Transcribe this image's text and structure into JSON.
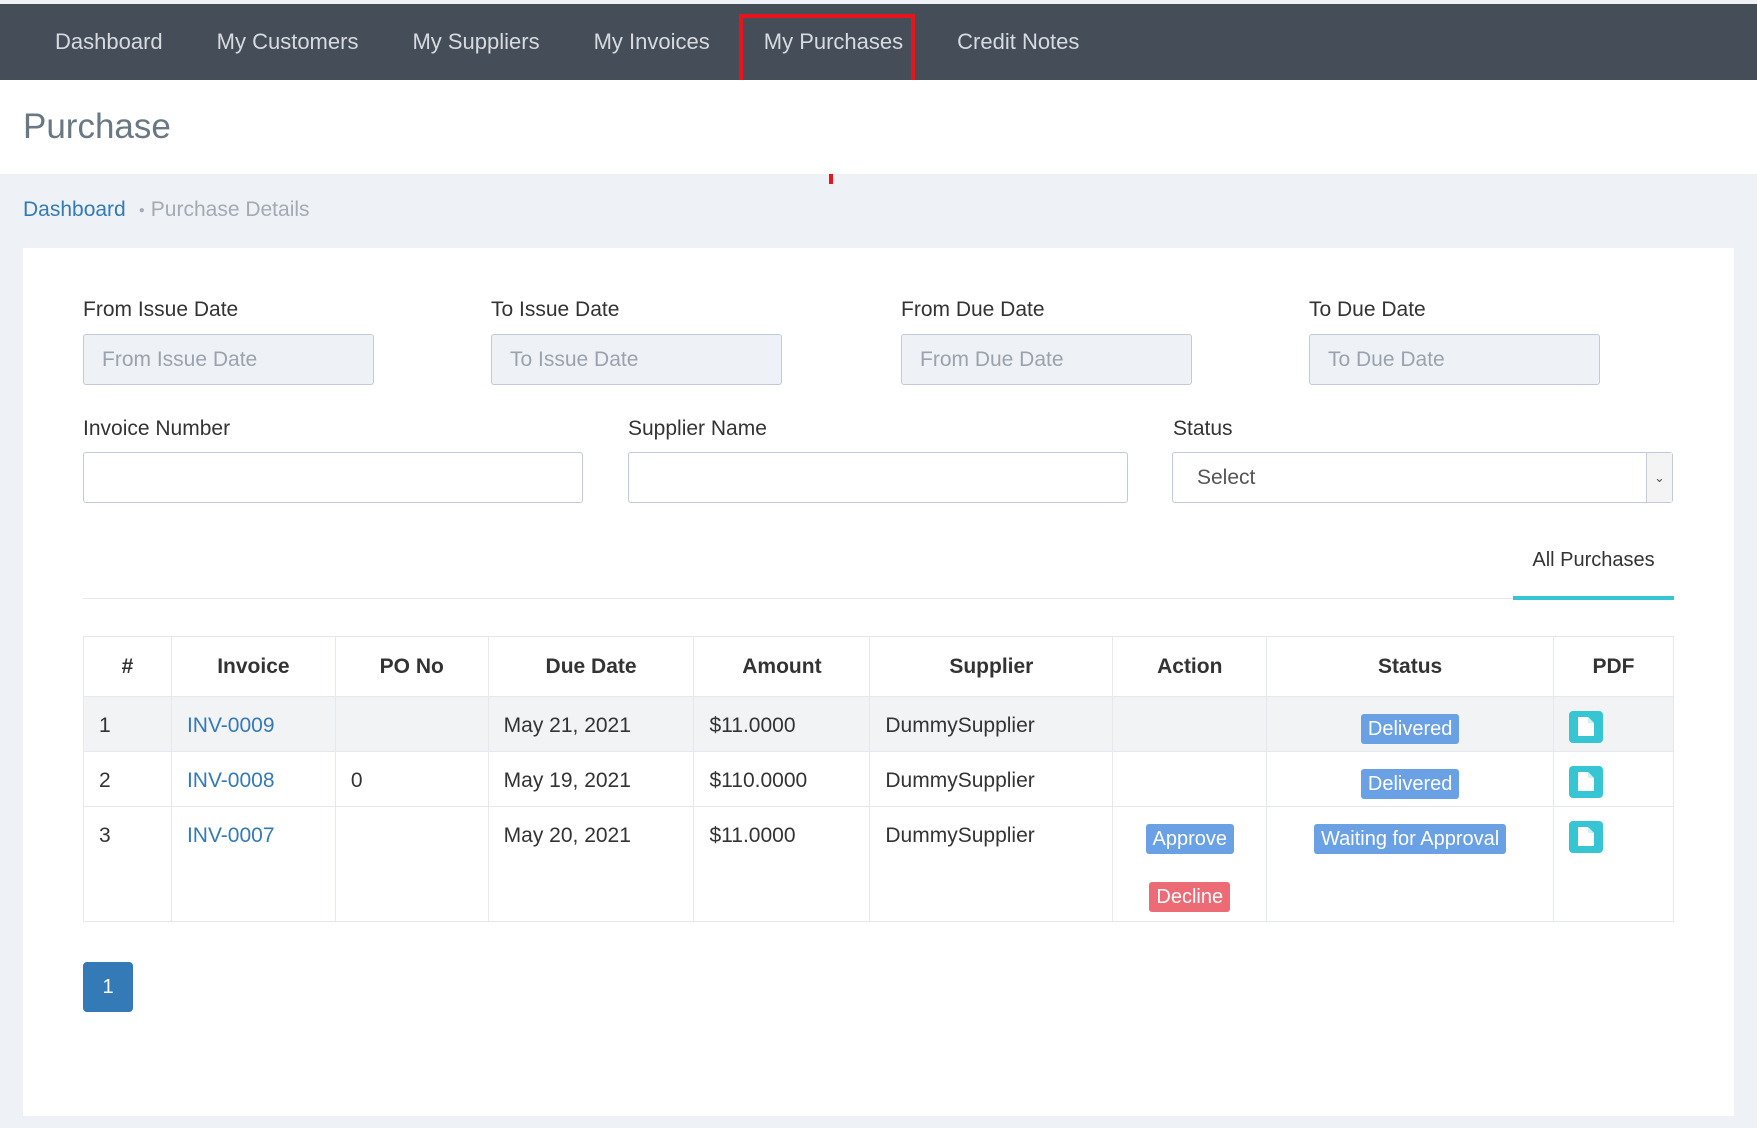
{
  "nav": {
    "items": [
      "Dashboard",
      "My Customers",
      "My Suppliers",
      "My Invoices",
      "My Purchases",
      "Credit Notes"
    ]
  },
  "page": {
    "title": "Purchase"
  },
  "breadcrumb": {
    "home": "Dashboard",
    "current": "Purchase Details"
  },
  "filters": {
    "from_issue_label": "From Issue Date",
    "from_issue_placeholder": "From Issue Date",
    "to_issue_label": "To Issue Date",
    "to_issue_placeholder": "To Issue Date",
    "from_due_label": "From Due Date",
    "from_due_placeholder": "From Due Date",
    "to_due_label": "To Due Date",
    "to_due_placeholder": "To Due Date",
    "invoice_number_label": "Invoice Number",
    "invoice_number_value": "",
    "supplier_name_label": "Supplier Name",
    "supplier_name_value": "",
    "status_label": "Status",
    "status_value": "Select"
  },
  "tabs": {
    "all_purchases": "All Purchases"
  },
  "table": {
    "headers": [
      "#",
      "Invoice",
      "PO No",
      "Due Date",
      "Amount",
      "Supplier",
      "Action",
      "Status",
      "PDF"
    ],
    "rows": [
      {
        "num": "1",
        "invoice": "INV-0009",
        "po": "",
        "due": "May 21, 2021",
        "amount": "$11.0000",
        "supplier": "DummySupplier",
        "status": "Delivered"
      },
      {
        "num": "2",
        "invoice": "INV-0008",
        "po": "0",
        "due": "May 19, 2021",
        "amount": "$110.0000",
        "supplier": "DummySupplier",
        "status": "Delivered"
      },
      {
        "num": "3",
        "invoice": "INV-0007",
        "po": "",
        "due": "May 20, 2021",
        "amount": "$11.0000",
        "supplier": "DummySupplier",
        "approve": "Approve",
        "decline": "Decline",
        "status": "Waiting for Approval"
      }
    ]
  },
  "pagination": {
    "current": "1"
  },
  "colors": {
    "nav_bg": "#454d59",
    "annotation_red": "#e8141b",
    "link_blue": "#337ab7",
    "teal": "#36c6d3",
    "decline_red": "#ed6b75"
  }
}
